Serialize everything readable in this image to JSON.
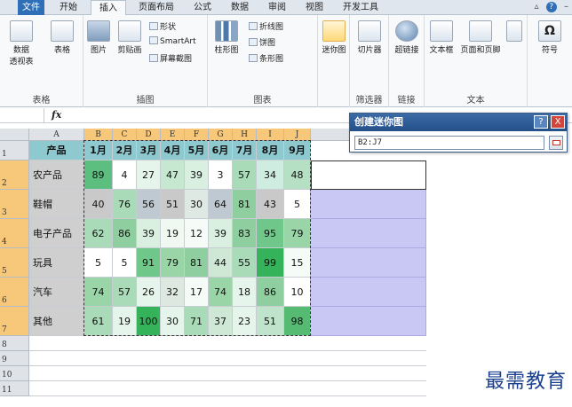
{
  "ribbon": {
    "tabs": [
      {
        "label": "文件",
        "state": "file"
      },
      {
        "label": "开始",
        "state": ""
      },
      {
        "label": "插入",
        "state": "active"
      },
      {
        "label": "页面布局",
        "state": ""
      },
      {
        "label": "公式",
        "state": ""
      },
      {
        "label": "数据",
        "state": ""
      },
      {
        "label": "审阅",
        "state": ""
      },
      {
        "label": "视图",
        "state": ""
      },
      {
        "label": "开发工具",
        "state": ""
      }
    ],
    "window_help": "?",
    "groups": {
      "tables": {
        "label": "表格",
        "pivot": "数据\n透视表",
        "table": "表格"
      },
      "illustrations": {
        "label": "插图",
        "picture": "图片",
        "clipart": "剪贴画",
        "shapes": "形状",
        "smartart": "SmartArt",
        "screenshot": "屏幕截图"
      },
      "charts": {
        "label": "图表",
        "column": "柱形图",
        "line": "折线图",
        "pie": "饼图",
        "bar": "条形图"
      },
      "sparklines": {
        "label": "",
        "line": "迷你图"
      },
      "filter": {
        "label": "筛选器",
        "slicer": "切片器"
      },
      "links": {
        "label": "链接",
        "hyperlink": "超链接"
      },
      "text": {
        "label": "文本",
        "textbox": "文本框",
        "header_footer": "页面和页脚"
      },
      "symbols": {
        "symbol": "符号",
        "omega": "Ω"
      }
    }
  },
  "formula_bar": {
    "fx": "fx"
  },
  "sheet": {
    "columns": [
      "A",
      "B",
      "C",
      "D",
      "E",
      "F",
      "G",
      "H",
      "I",
      "J"
    ],
    "row_numbers": [
      "1",
      "2",
      "3",
      "4",
      "5",
      "6",
      "7",
      "8",
      "9",
      "10",
      "11"
    ],
    "header": [
      "产品",
      "1月",
      "2月",
      "3月",
      "4月",
      "5月",
      "6月",
      "7月",
      "8月",
      "9月"
    ],
    "rows": [
      {
        "product": "农产品",
        "values": [
          "89",
          "4",
          "27",
          "47",
          "39",
          "3",
          "57",
          "34",
          "48"
        ]
      },
      {
        "product": "鞋帽",
        "values": [
          "40",
          "76",
          "56",
          "51",
          "30",
          "64",
          "81",
          "43",
          "5"
        ]
      },
      {
        "product": "电子产品",
        "values": [
          "62",
          "86",
          "39",
          "19",
          "12",
          "39",
          "83",
          "95",
          "79"
        ]
      },
      {
        "product": "玩具",
        "values": [
          "5",
          "5",
          "91",
          "79",
          "81",
          "44",
          "55",
          "99",
          "15"
        ]
      },
      {
        "product": "汽车",
        "values": [
          "74",
          "57",
          "26",
          "32",
          "17",
          "74",
          "18",
          "86",
          "10"
        ]
      },
      {
        "product": "其他",
        "values": [
          "61",
          "19",
          "100",
          "30",
          "71",
          "37",
          "23",
          "51",
          "98"
        ]
      }
    ],
    "cell_colors": [
      [
        "#5cbf7f",
        "#ffffff",
        "#e6f5ec",
        "#c7e8d0",
        "#d9efe0",
        "#ffffff",
        "#a9dbb8",
        "#cfece0",
        "#b6e0c4"
      ],
      [
        "#c9c9c9",
        "#a9dbb8",
        "#bfc9d1",
        "#c9c9c9",
        "#dfe9e3",
        "#bfc9d1",
        "#8fcf9f",
        "#c9c9c9",
        "#ffffff"
      ],
      [
        "#a9dbb8",
        "#8fcf9f",
        "#d9efe0",
        "#f0f8f2",
        "#f7fbf8",
        "#d9efe0",
        "#8fcf9f",
        "#6fc78a",
        "#9ad5a8"
      ],
      [
        "#ffffff",
        "#ffffff",
        "#6fc78a",
        "#9ad5a8",
        "#8fcf9f",
        "#cfe8d5",
        "#a9dbb8",
        "#34b35a",
        "#f5fbf6"
      ],
      [
        "#9ad5a8",
        "#a9dbb8",
        "#e6f5ec",
        "#dde9e0",
        "#f5fbf6",
        "#9ad5a8",
        "#e6f5ec",
        "#8fcf9f",
        "#ffffff"
      ],
      [
        "#a9dbb8",
        "#e6f5ec",
        "#34b35a",
        "#e6f5ec",
        "#a9dbb8",
        "#cfe8d5",
        "#e6f5ec",
        "#bfe4cb",
        "#56bb72"
      ]
    ]
  },
  "dialog": {
    "title": "创建迷你图",
    "range_value": "B2:J7",
    "help": "?",
    "close": "X"
  },
  "watermark": "最需教育"
}
